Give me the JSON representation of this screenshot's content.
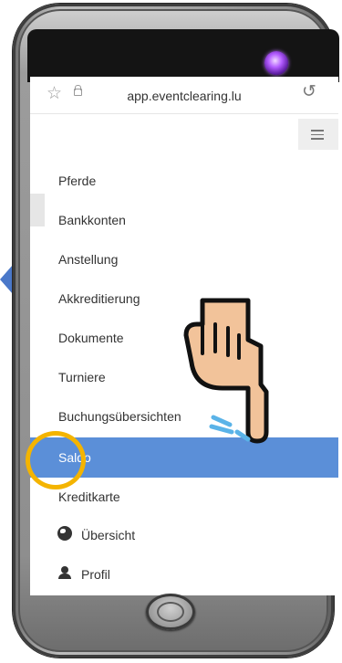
{
  "browser": {
    "url": "app.eventclearing.lu"
  },
  "menu": {
    "items": [
      {
        "label": "Pferde"
      },
      {
        "label": "Bankkonten"
      },
      {
        "label": "Anstellung"
      },
      {
        "label": "Akkreditierung"
      },
      {
        "label": "Dokumente"
      },
      {
        "label": "Turniere"
      },
      {
        "label": "Buchungsübersichten"
      },
      {
        "label": "Saldo",
        "active": true
      },
      {
        "label": "Kreditkarte"
      },
      {
        "label": "Übersicht",
        "icon": "globe-icon"
      },
      {
        "label": "Profil",
        "icon": "user-icon"
      }
    ]
  },
  "colors": {
    "active_item": "#5b8fd8",
    "highlight_ring": "#f4b400",
    "camera": "#b35cff"
  },
  "icons": {
    "star": "star-icon",
    "lock": "lock-icon",
    "reload": "reload-icon",
    "menu": "hamburger-icon",
    "hand": "pointing-hand-icon"
  }
}
